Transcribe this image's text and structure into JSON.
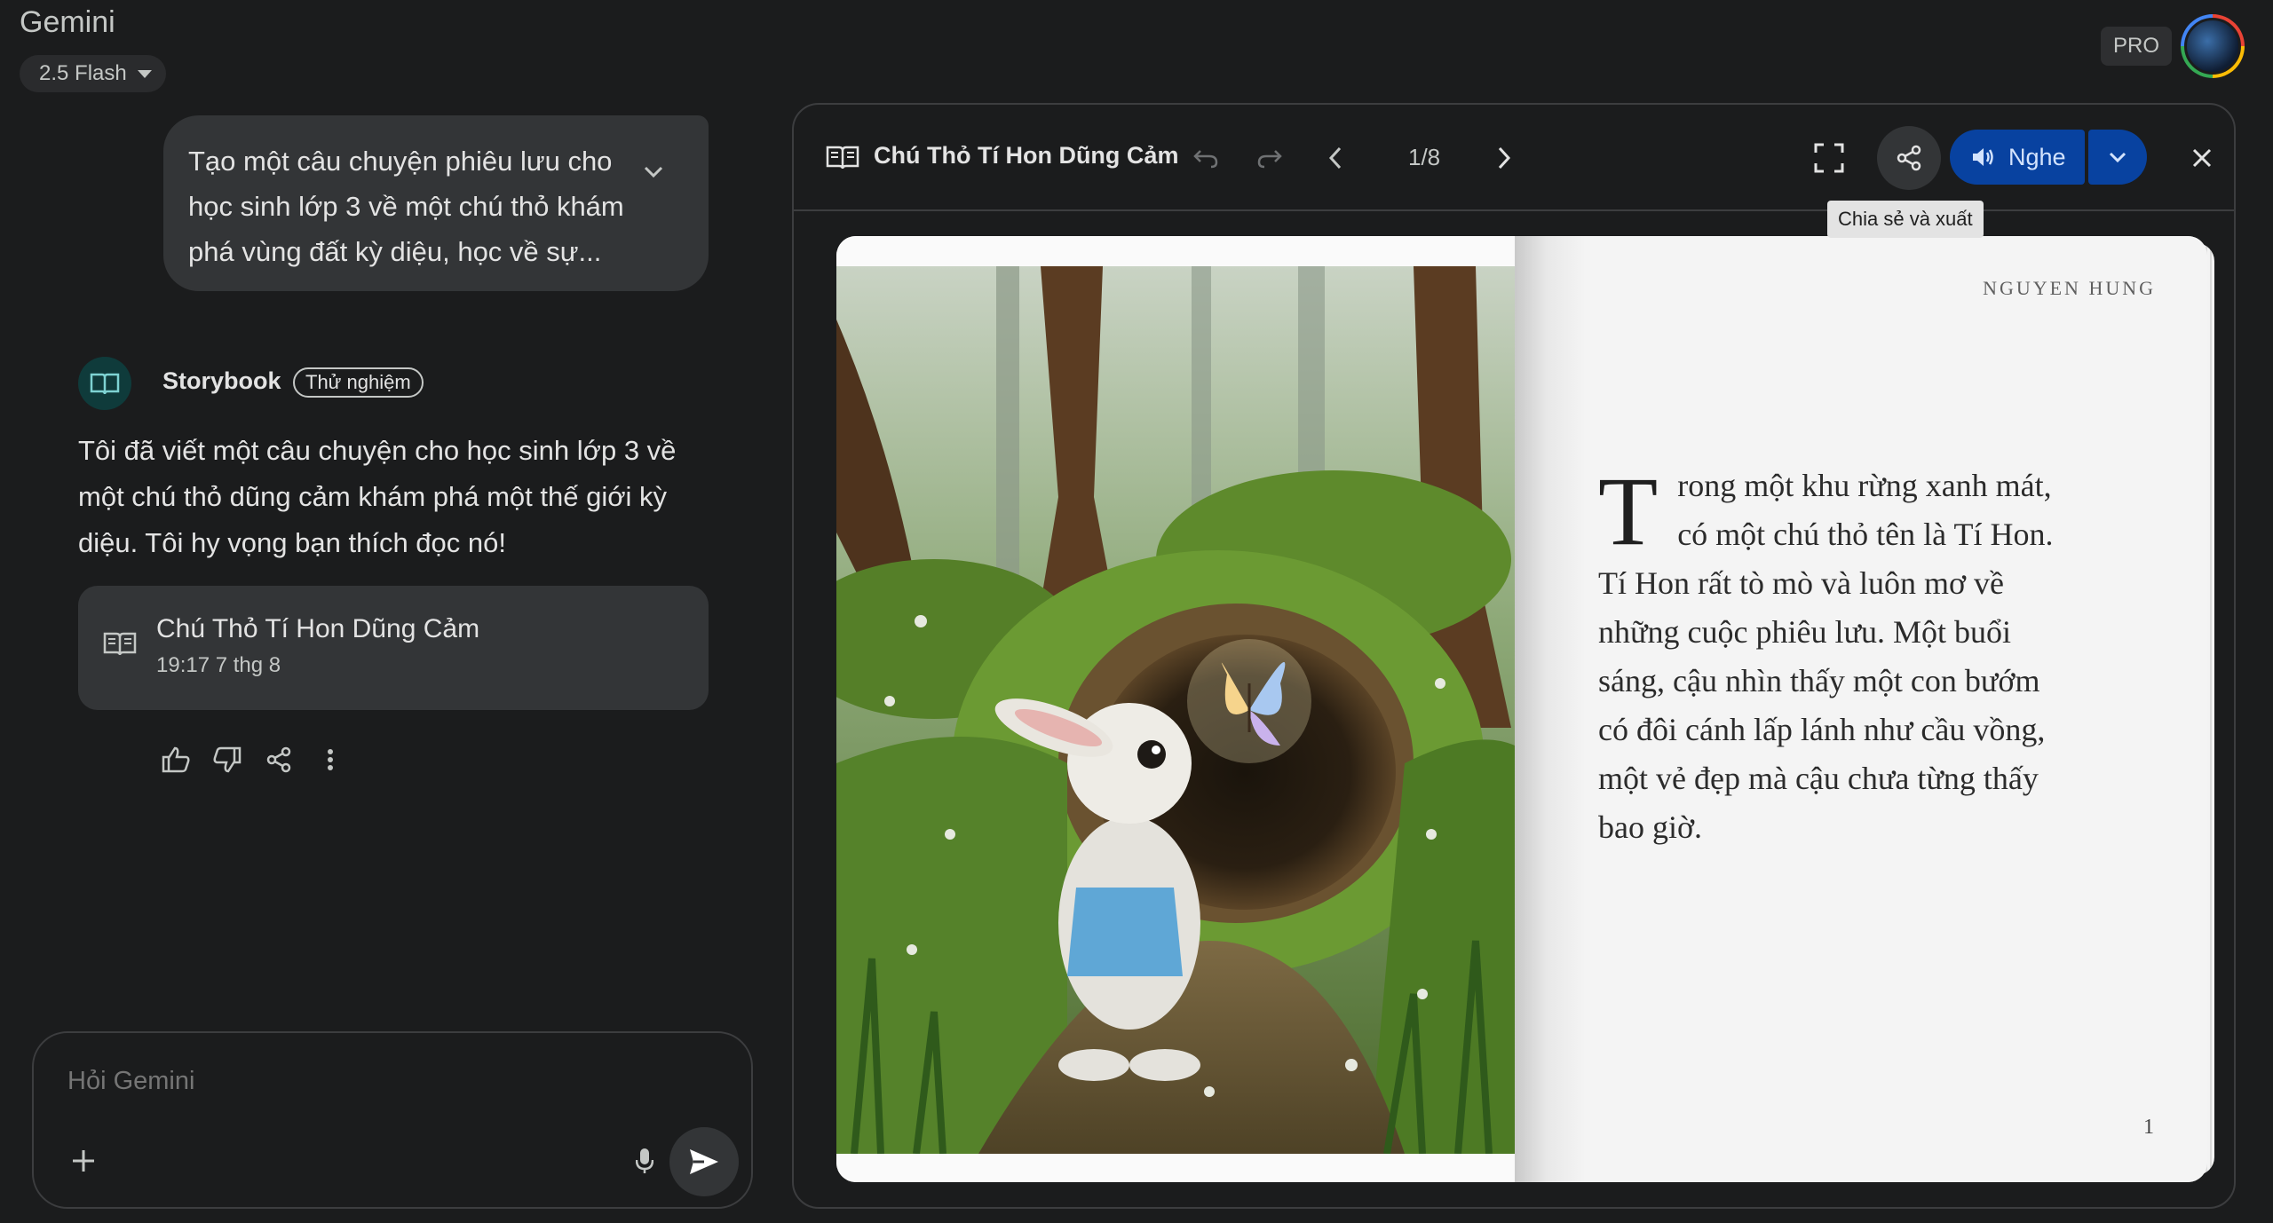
{
  "app": {
    "title": "Gemini",
    "model": "2.5 Flash",
    "plan_badge": "PRO"
  },
  "chat": {
    "user_prompt": "Tạo một câu chuyện phiêu lưu cho học sinh lớp 3 về một chú thỏ khám phá vùng đất kỳ diệu, học về sự...",
    "bot_name": "Storybook",
    "bot_badge": "Thử nghiệm",
    "bot_message": "Tôi đã viết một câu chuyện cho học sinh lớp 3 về một chú thỏ dũng cảm khám phá một thế giới kỳ diệu. Tôi hy vọng bạn thích đọc nó!",
    "story_card": {
      "title": "Chú Thỏ Tí Hon Dũng Cảm",
      "timestamp": "19:17 7 thg 8"
    },
    "actions": [
      "thumb-up-icon",
      "thumb-down-icon",
      "share-icon",
      "more-vert-icon"
    ]
  },
  "input": {
    "placeholder": "Hỏi Gemini"
  },
  "storybook": {
    "title": "Chú Thỏ Tí Hon Dũng Cảm",
    "page_indicator": "1/8",
    "listen_label": "Nghe",
    "tooltip": "Chia sẻ và xuất",
    "author": "NGUYEN HUNG",
    "dropcap": "T",
    "text": "rong một khu rừng xanh mát, có một chú thỏ tên là Tí Hon. Tí Hon rất tò mò và luôn mơ về những cuộc phiêu lưu. Một buổi sáng, cậu nhìn thấy một con bướm có đôi cánh lấp lánh như cầu vồng, một vẻ đẹp mà cậu chưa từng thấy bao giờ.",
    "page_number": "1"
  },
  "colors": {
    "background": "#1b1c1d",
    "surface": "#333537",
    "accent": "#0842a0",
    "accent_text": "#d3e3fd"
  }
}
